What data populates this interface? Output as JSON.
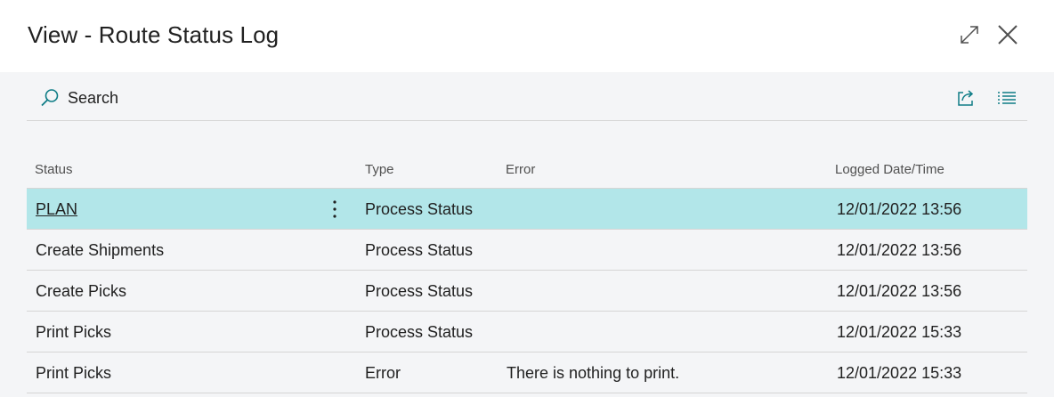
{
  "window": {
    "title": "View - Route Status Log",
    "expand_icon": "expand-icon",
    "close_icon": "close-icon"
  },
  "toolbar": {
    "search_label": "Search",
    "search_icon": "search-icon",
    "share_icon": "share-icon",
    "list_view_icon": "list-view-icon",
    "accent_color": "#0e7c86"
  },
  "grid": {
    "columns": {
      "status": "Status",
      "type": "Type",
      "error": "Error",
      "logged": "Logged Date/Time"
    },
    "rows": [
      {
        "status": "PLAN",
        "type": "Process Status",
        "error": "",
        "logged": "12/01/2022 13:56",
        "selected": true
      },
      {
        "status": "Create Shipments",
        "type": "Process Status",
        "error": "",
        "logged": "12/01/2022 13:56"
      },
      {
        "status": "Create Picks",
        "type": "Process Status",
        "error": "",
        "logged": "12/01/2022 13:56"
      },
      {
        "status": "Print Picks",
        "type": "Process Status",
        "error": "",
        "logged": "12/01/2022 15:33"
      },
      {
        "status": "Print Picks",
        "type": "Error",
        "error": "There is nothing to print.",
        "logged": "12/01/2022 15:33"
      }
    ],
    "selected_row_color": "#b2e6e9"
  }
}
